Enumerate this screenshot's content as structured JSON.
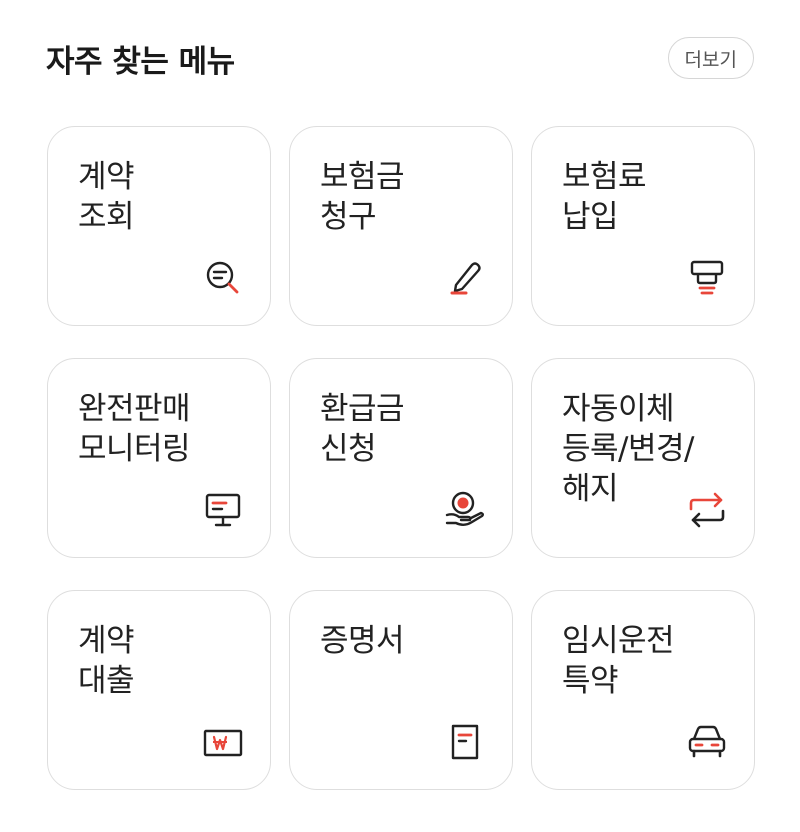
{
  "header": {
    "title": "자주 찾는 메뉴",
    "more_label": "더보기"
  },
  "colors": {
    "accent": "#e8463a",
    "icon_stroke": "#222222",
    "tile_border": "#dedede"
  },
  "tiles": [
    {
      "label": "계약\n조회",
      "icon": "search-document-icon"
    },
    {
      "label": "보험금\n청구",
      "icon": "pen-icon"
    },
    {
      "label": "보험료\n납입",
      "icon": "atm-icon"
    },
    {
      "label": "완전판매\n모니터링",
      "icon": "monitor-icon"
    },
    {
      "label": "환급금\n신청",
      "icon": "hand-coin-icon"
    },
    {
      "label": "자동이체\n등록/변경/\n해지",
      "icon": "repeat-arrows-icon"
    },
    {
      "label": "계약\n대출",
      "icon": "won-card-icon"
    },
    {
      "label": "증명서",
      "icon": "certificate-document-icon"
    },
    {
      "label": "임시운전\n특약",
      "icon": "car-icon"
    }
  ]
}
